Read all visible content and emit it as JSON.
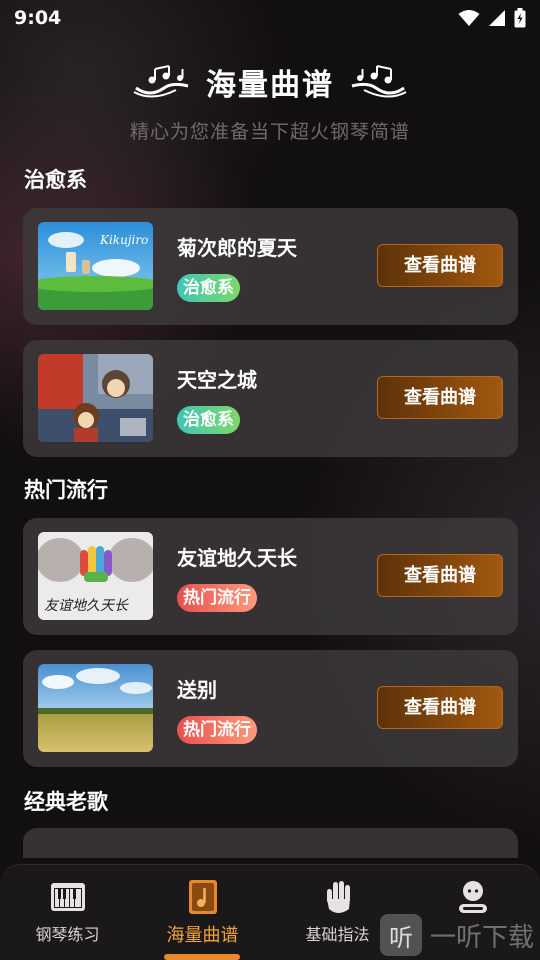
{
  "status_bar": {
    "time": "9:04"
  },
  "header": {
    "title": "海量曲谱",
    "subtitle": "精心为您准备当下超火钢琴简谱"
  },
  "sections": [
    {
      "title": "治愈系",
      "songs": [
        {
          "title": "菊次郎的夏天",
          "tag": "治愈系",
          "button": "查看曲谱"
        },
        {
          "title": "天空之城",
          "tag": "治愈系",
          "button": "查看曲谱"
        }
      ]
    },
    {
      "title": "热门流行",
      "songs": [
        {
          "title": "友谊地久天长",
          "tag": "热门流行",
          "button": "查看曲谱"
        },
        {
          "title": "送别",
          "tag": "热门流行",
          "button": "查看曲谱"
        }
      ]
    },
    {
      "title": "经典老歌"
    }
  ],
  "thumbnails": {
    "kikujiro_text": "Kikujiro",
    "auld_lang_syne_text": "友谊地久天长"
  },
  "tabs": [
    {
      "label": "钢琴练习",
      "icon": "piano-icon",
      "active": false
    },
    {
      "label": "海量曲谱",
      "icon": "music-book-icon",
      "active": true
    },
    {
      "label": "基础指法",
      "icon": "hand-icon",
      "active": false
    },
    {
      "label": "",
      "icon": "profile-icon",
      "active": false
    }
  ],
  "watermark": {
    "logo": "听",
    "text": "一听下载"
  },
  "colors": {
    "accent": "#f2a43b",
    "button_from": "#5d3208",
    "button_to": "#a2580f",
    "tag_heal": "#3fc6b4",
    "tag_hot": "#e8504e"
  }
}
